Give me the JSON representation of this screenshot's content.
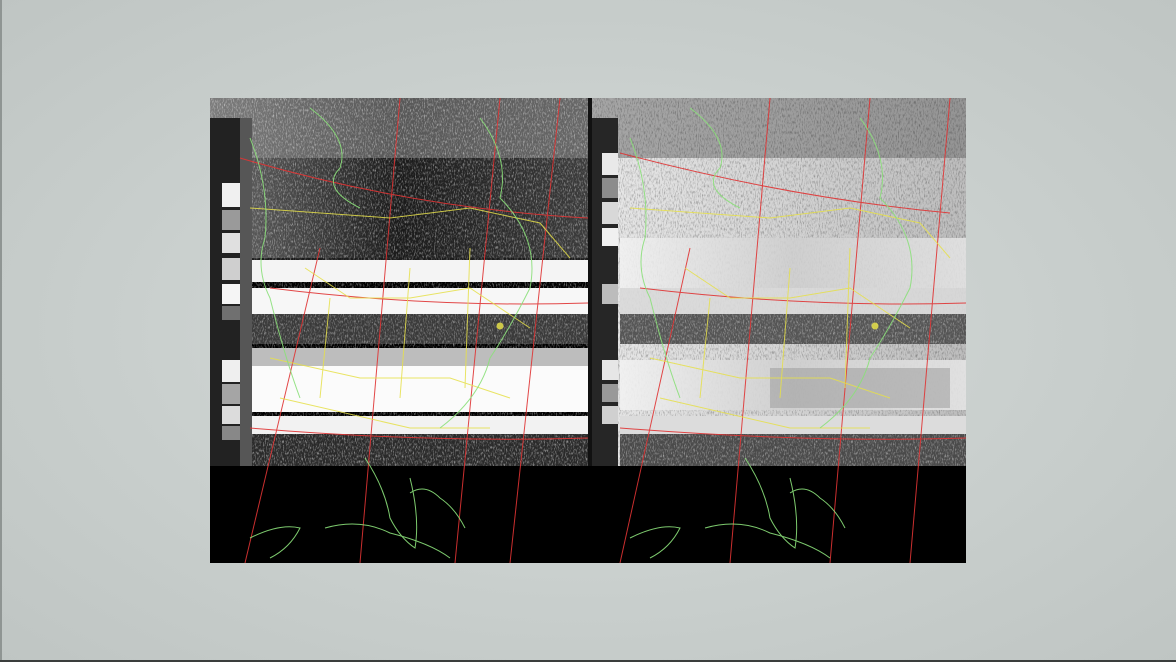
{
  "slide": {
    "background_color": "#cdd2d0",
    "image": {
      "type": "satellite-weather-image",
      "description_label": "",
      "channels": [
        "channel-a",
        "channel-b"
      ],
      "overlay_colors": {
        "coastline": "#8be07a",
        "political_borders": "#e6e04a",
        "grid_lines": "#e03434"
      }
    }
  }
}
